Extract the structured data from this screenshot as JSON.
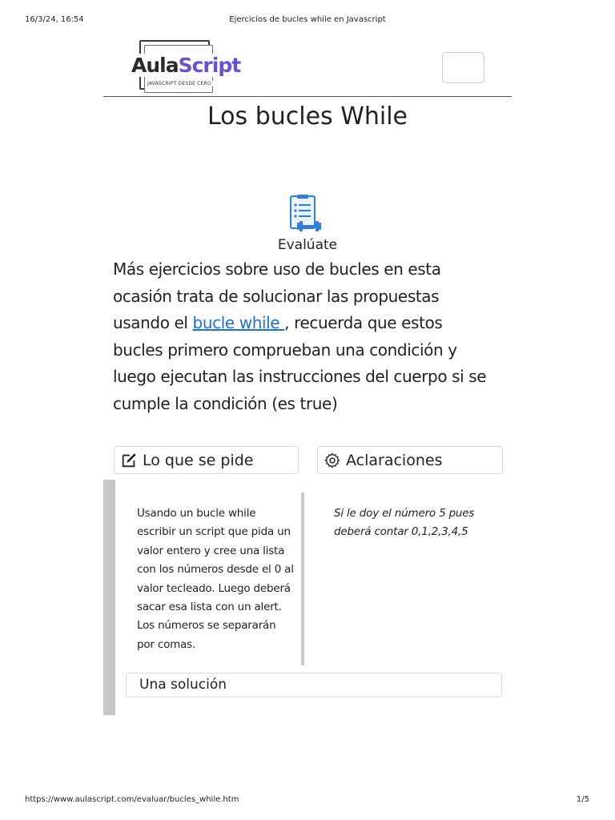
{
  "print_header": {
    "date": "16/3/24, 16:54",
    "title": "Ejercicios de bucles while en Javascript"
  },
  "logo": {
    "brand_part1": "Aula",
    "brand_part2": "Script",
    "tagline": "JAVASCRIPT DESDE CERO"
  },
  "page_title": "Los bucles While",
  "evaluate_label": "Evalúate",
  "intro": {
    "before_link": "Más ejercicios sobre uso de bucles en esta ocasión trata de solucionar las propuestas usando el ",
    "link_text": "bucle while ",
    "after_link": ", recuerda que estos bucles primero comprueban una condición y luego ejecutan las instrucciones del cuerpo si se cumple la condición (es true)"
  },
  "cards": {
    "pide_label": "Lo que se pide",
    "aclaraciones_label": "Aclaraciones"
  },
  "pide_text": "Usando un bucle while escribir un script que pida un valor entero y cree una lista con los números desde el 0 al valor tecleado. Luego deberá sacar esa lista con un alert. Los números se separarán por comas.",
  "aclaraciones_text": "Si le doy el número 5 pues deberá contar 0,1,2,3,4,5",
  "solution_label": "Una solución",
  "print_footer": {
    "url": "https://www.aulascript.com/evaluar/bucles_while.htm",
    "page": "1/5"
  },
  "colors": {
    "link": "#1a6fdc",
    "brand_accent": "#6a4fd0"
  },
  "icons": {
    "evaluate": "clipboard-dumbbell-icon",
    "pide": "edit-icon",
    "aclaraciones": "gear-icon"
  }
}
